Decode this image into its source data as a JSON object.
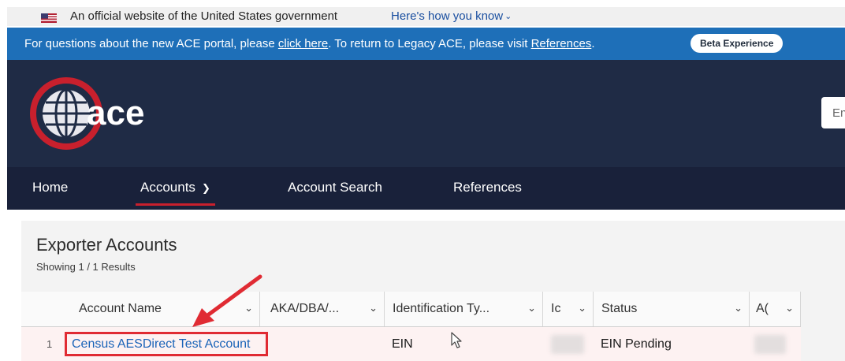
{
  "gov_banner": {
    "text": "An official website of the United States government",
    "link": "Here's how you know"
  },
  "notice": {
    "part1": "For questions about the new ACE portal, please ",
    "link1": "click here",
    "part2": ".   To return to Legacy ACE, please visit ",
    "link2": "References",
    "part3": ".",
    "beta_button": "Beta Experience"
  },
  "header": {
    "logo_text": "ace",
    "search_placeholder": "En"
  },
  "nav": {
    "items": [
      {
        "label": "Home"
      },
      {
        "label": "Accounts"
      },
      {
        "label": "Account Search"
      },
      {
        "label": "References"
      }
    ]
  },
  "card": {
    "title": "Exporter Accounts",
    "subtitle": "Showing 1 / 1 Results"
  },
  "table": {
    "columns": [
      {
        "label": "Account Name"
      },
      {
        "label": "AKA/DBA/..."
      },
      {
        "label": "Identification Ty..."
      },
      {
        "label": "Ic"
      },
      {
        "label": "Status"
      },
      {
        "label": "A("
      }
    ],
    "rows": [
      {
        "num": "1",
        "account_name": "Census AESDirect Test Account",
        "aka": "",
        "id_type": "EIN",
        "status": "EIN Pending"
      }
    ]
  },
  "colors": {
    "notice_bg": "#1e6fb8",
    "header_bg": "#1f2b45",
    "nav_bg": "#19213a",
    "active_underline": "#c8202d",
    "highlight": "#e02b33",
    "link": "#1a63b8"
  },
  "icons": [
    "us-flag-icon",
    "chevron-down-icon",
    "ace-globe-logo",
    "mouse-cursor-icon",
    "red-arrow-annotation"
  ]
}
